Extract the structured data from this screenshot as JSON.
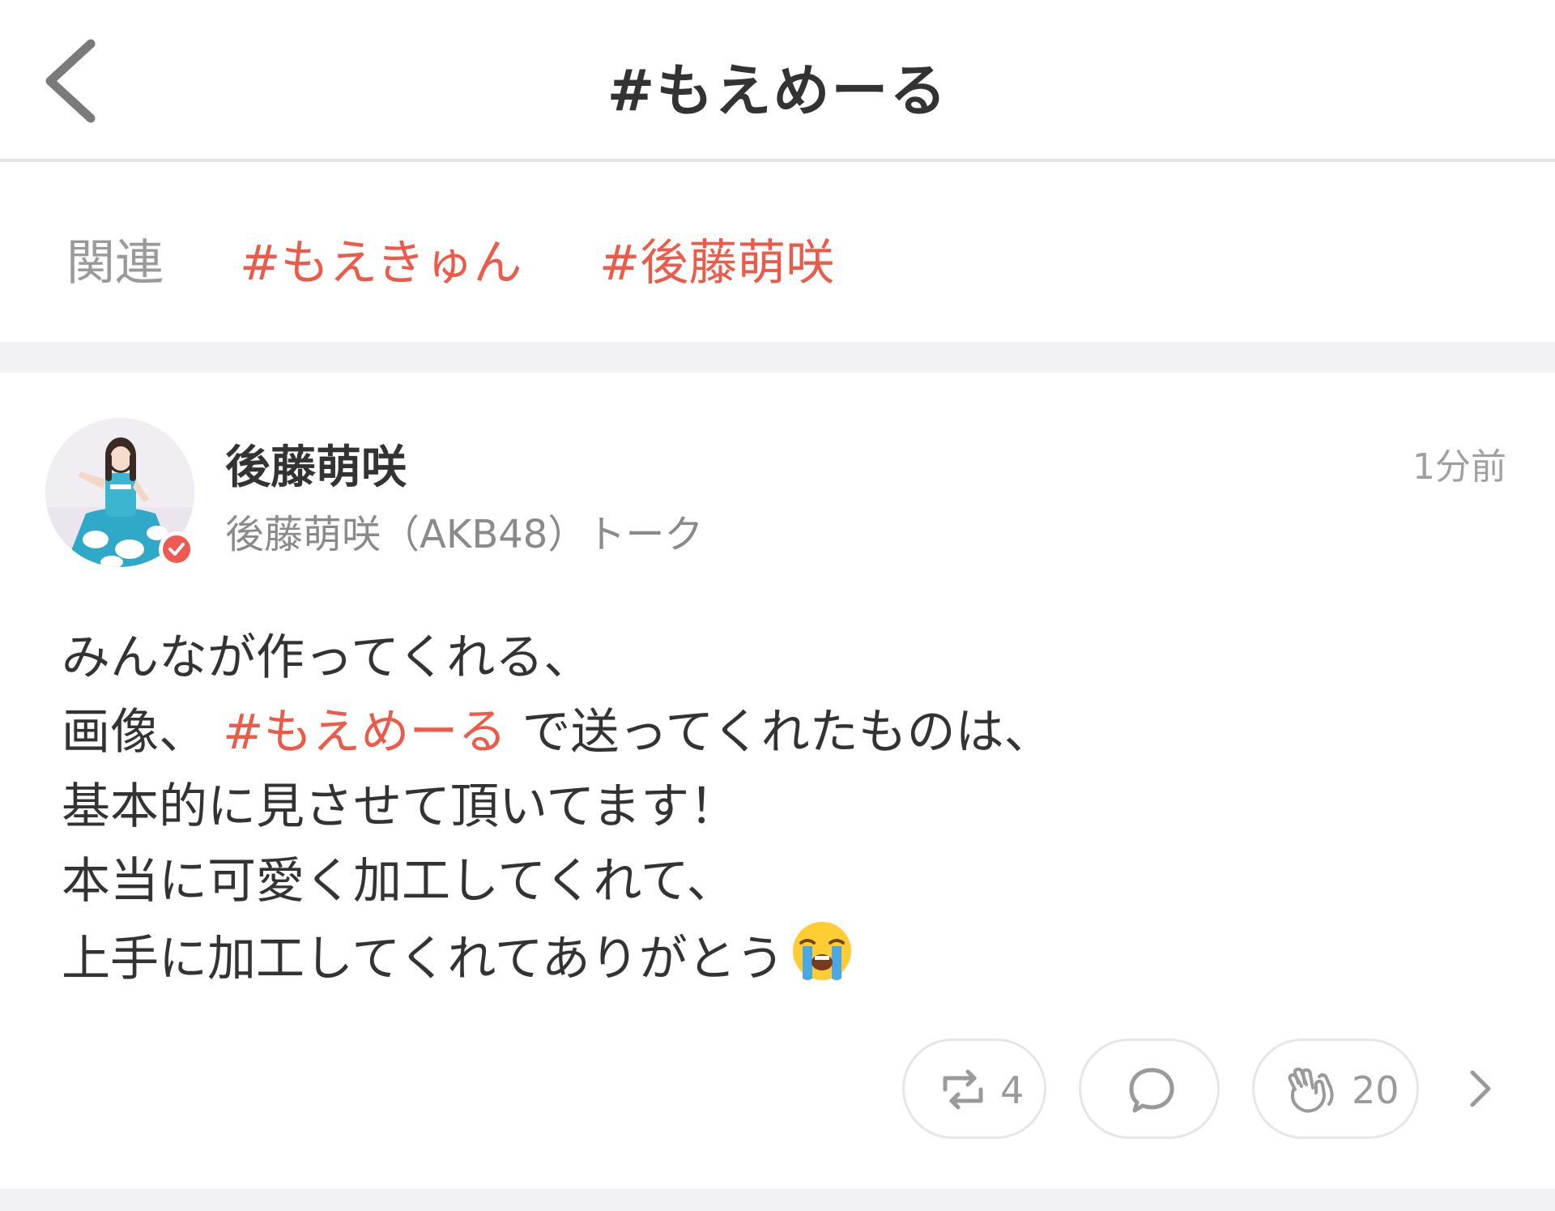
{
  "header": {
    "title": "#もえめーる",
    "back_icon": "chevron-left-icon"
  },
  "related": {
    "label": "関連",
    "tags": [
      "#もえきゅん",
      "#後藤萌咲"
    ]
  },
  "post": {
    "author": {
      "name": "後藤萌咲",
      "community": "後藤萌咲（AKB48）トーク",
      "verified": true
    },
    "time": "1分前",
    "body": {
      "line1": "みんなが作ってくれる、",
      "line2_prefix": "画像、",
      "line2_tag": "#もえめーる",
      "line2_suffix": "で送ってくれたものは、",
      "line3": "基本的に見させて頂いてます！",
      "line4": "本当に可愛く加工してくれて、",
      "line5": "上手に加工してくれてありがとう",
      "line5_emoji": "loudly-crying-face-emoji"
    },
    "actions": {
      "repost_count": "4",
      "clap_count": "20"
    }
  },
  "colors": {
    "accent": "#ec5a4a",
    "verified": "#ee5a52",
    "separator": "#f2f2f4",
    "text": "#333333",
    "muted": "#9a9a9a"
  }
}
